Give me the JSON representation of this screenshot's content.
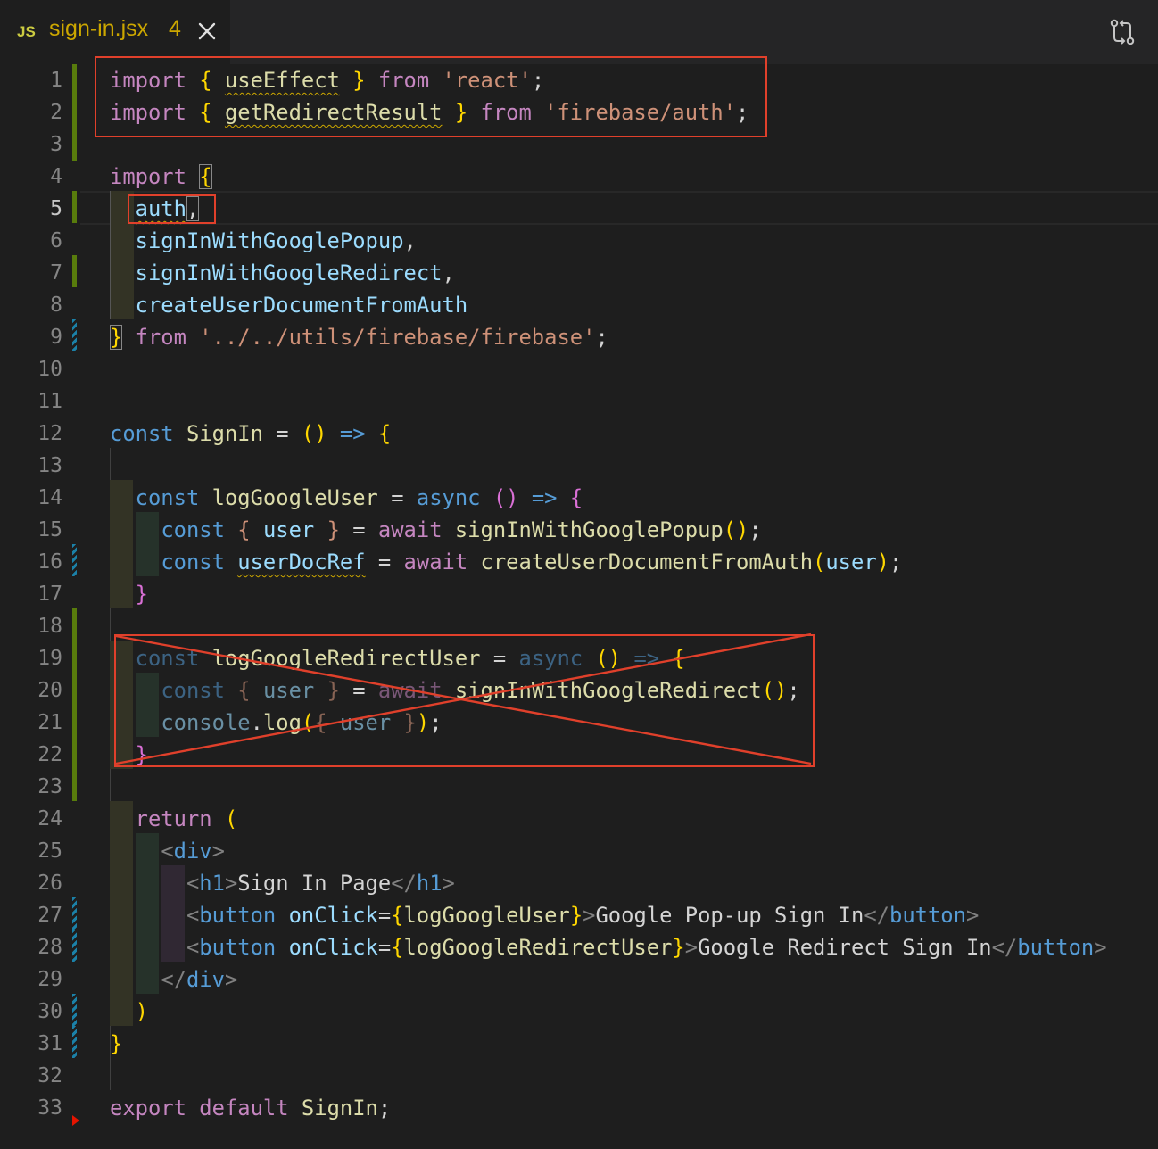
{
  "tab": {
    "language_badge": "JS",
    "filename": "sign-in.jsx",
    "problem_count": "4"
  },
  "icons": {
    "close": "close-icon",
    "compare": "git-compare-icon"
  },
  "colors": {
    "background": "#1e1e1e",
    "annotation": "#e0402b",
    "warning": "#cca700",
    "added": "#587c0c",
    "modified": "#1b81a8"
  },
  "editor": {
    "current_line": "5",
    "lines": [
      {
        "n": "1",
        "tokens": [
          [
            "k",
            "import"
          ],
          [
            "p",
            " "
          ],
          [
            "y",
            "{"
          ],
          [
            "p",
            " "
          ],
          [
            "f",
            "useEffect"
          ],
          [
            "p",
            " "
          ],
          [
            "y",
            "}"
          ],
          [
            "p",
            " "
          ],
          [
            "k",
            "from"
          ],
          [
            "p",
            " "
          ],
          [
            "s",
            "'react'"
          ],
          [
            "p",
            ";"
          ]
        ]
      },
      {
        "n": "2",
        "tokens": [
          [
            "k",
            "import"
          ],
          [
            "p",
            " "
          ],
          [
            "y",
            "{"
          ],
          [
            "p",
            " "
          ],
          [
            "f",
            "getRedirectResult"
          ],
          [
            "p",
            " "
          ],
          [
            "y",
            "}"
          ],
          [
            "p",
            " "
          ],
          [
            "k",
            "from"
          ],
          [
            "p",
            " "
          ],
          [
            "s",
            "'firebase/auth'"
          ],
          [
            "p",
            ";"
          ]
        ]
      },
      {
        "n": "3",
        "tokens": []
      },
      {
        "n": "4",
        "tokens": [
          [
            "k",
            "import"
          ],
          [
            "p",
            " "
          ],
          [
            "y",
            "{"
          ]
        ]
      },
      {
        "n": "5",
        "tokens": [
          [
            "p",
            "  "
          ],
          [
            "v",
            "auth"
          ],
          [
            "p",
            ","
          ]
        ]
      },
      {
        "n": "6",
        "tokens": [
          [
            "p",
            "  "
          ],
          [
            "v",
            "signInWithGooglePopup"
          ],
          [
            "p",
            ","
          ]
        ]
      },
      {
        "n": "7",
        "tokens": [
          [
            "p",
            "  "
          ],
          [
            "v",
            "signInWithGoogleRedirect"
          ],
          [
            "p",
            ","
          ]
        ]
      },
      {
        "n": "8",
        "tokens": [
          [
            "p",
            "  "
          ],
          [
            "v",
            "createUserDocumentFromAuth"
          ]
        ]
      },
      {
        "n": "9",
        "tokens": [
          [
            "y",
            "}"
          ],
          [
            "p",
            " "
          ],
          [
            "k",
            "from"
          ],
          [
            "p",
            " "
          ],
          [
            "s",
            "'../../utils/firebase/firebase'"
          ],
          [
            "p",
            ";"
          ]
        ]
      },
      {
        "n": "10",
        "tokens": []
      },
      {
        "n": "11",
        "tokens": []
      },
      {
        "n": "12",
        "tokens": [
          [
            "b",
            "const"
          ],
          [
            "p",
            " "
          ],
          [
            "f",
            "SignIn"
          ],
          [
            "p",
            " = "
          ],
          [
            "y",
            "()"
          ],
          [
            "p",
            " "
          ],
          [
            "b",
            "=>"
          ],
          [
            "p",
            " "
          ],
          [
            "y",
            "{"
          ]
        ]
      },
      {
        "n": "13",
        "tokens": []
      },
      {
        "n": "14",
        "tokens": [
          [
            "p",
            "  "
          ],
          [
            "b",
            "const"
          ],
          [
            "p",
            " "
          ],
          [
            "f",
            "logGoogleUser"
          ],
          [
            "p",
            " = "
          ],
          [
            "b",
            "async"
          ],
          [
            "p",
            " "
          ],
          [
            "m",
            "()"
          ],
          [
            "p",
            " "
          ],
          [
            "b",
            "=>"
          ],
          [
            "p",
            " "
          ],
          [
            "m",
            "{"
          ]
        ]
      },
      {
        "n": "15",
        "tokens": [
          [
            "p",
            "    "
          ],
          [
            "b",
            "const"
          ],
          [
            "p",
            " "
          ],
          [
            "s",
            "{"
          ],
          [
            "p",
            " "
          ],
          [
            "v",
            "user"
          ],
          [
            "p",
            " "
          ],
          [
            "s",
            "}"
          ],
          [
            "p",
            " = "
          ],
          [
            "k",
            "await"
          ],
          [
            "p",
            " "
          ],
          [
            "f",
            "signInWithGooglePopup"
          ],
          [
            "y",
            "()"
          ],
          [
            "p",
            ";"
          ]
        ]
      },
      {
        "n": "16",
        "tokens": [
          [
            "p",
            "    "
          ],
          [
            "b",
            "const"
          ],
          [
            "p",
            " "
          ],
          [
            "v",
            "userDocRef"
          ],
          [
            "p",
            " = "
          ],
          [
            "k",
            "await"
          ],
          [
            "p",
            " "
          ],
          [
            "f",
            "createUserDocumentFromAuth"
          ],
          [
            "y",
            "("
          ],
          [
            "v",
            "user"
          ],
          [
            "y",
            ")"
          ],
          [
            "p",
            ";"
          ]
        ]
      },
      {
        "n": "17",
        "tokens": [
          [
            "p",
            "  "
          ],
          [
            "m",
            "}"
          ]
        ]
      },
      {
        "n": "18",
        "tokens": []
      },
      {
        "n": "19",
        "tokens": [
          [
            "p",
            "  "
          ],
          [
            "b",
            "const"
          ],
          [
            "p",
            " "
          ],
          [
            "f",
            "logGoogleRedirectUser"
          ],
          [
            "p",
            " = "
          ],
          [
            "b",
            "async"
          ],
          [
            "p",
            " "
          ],
          [
            "y",
            "()"
          ],
          [
            "p",
            " "
          ],
          [
            "b",
            "=>"
          ],
          [
            "p",
            " "
          ],
          [
            "y",
            "{"
          ]
        ]
      },
      {
        "n": "20",
        "tokens": [
          [
            "p",
            "    "
          ],
          [
            "b",
            "const"
          ],
          [
            "p",
            " "
          ],
          [
            "s",
            "{"
          ],
          [
            "p",
            " "
          ],
          [
            "v",
            "user"
          ],
          [
            "p",
            " "
          ],
          [
            "s",
            "}"
          ],
          [
            "p",
            " = "
          ],
          [
            "k",
            "await"
          ],
          [
            "p",
            " "
          ],
          [
            "f",
            "signInWithGoogleRedirect"
          ],
          [
            "y",
            "()"
          ],
          [
            "p",
            ";"
          ]
        ]
      },
      {
        "n": "21",
        "tokens": [
          [
            "p",
            "    "
          ],
          [
            "v",
            "console"
          ],
          [
            "p",
            "."
          ],
          [
            "f",
            "log"
          ],
          [
            "y",
            "("
          ],
          [
            "s",
            "{"
          ],
          [
            "p",
            " "
          ],
          [
            "v",
            "user"
          ],
          [
            "p",
            " "
          ],
          [
            "s",
            "}"
          ],
          [
            "y",
            ")"
          ],
          [
            "p",
            ";"
          ]
        ]
      },
      {
        "n": "22",
        "tokens": [
          [
            "p",
            "  "
          ],
          [
            "m",
            "}"
          ]
        ]
      },
      {
        "n": "23",
        "tokens": []
      },
      {
        "n": "24",
        "tokens": [
          [
            "p",
            "  "
          ],
          [
            "k",
            "return"
          ],
          [
            "p",
            " "
          ],
          [
            "y",
            "("
          ]
        ]
      },
      {
        "n": "25",
        "tokens": [
          [
            "p",
            "    "
          ],
          [
            "g",
            "<"
          ],
          [
            "b",
            "div"
          ],
          [
            "g",
            ">"
          ]
        ]
      },
      {
        "n": "26",
        "tokens": [
          [
            "p",
            "      "
          ],
          [
            "g",
            "<"
          ],
          [
            "b",
            "h1"
          ],
          [
            "g",
            ">"
          ],
          [
            "p",
            "Sign In Page"
          ],
          [
            "g",
            "</"
          ],
          [
            "b",
            "h1"
          ],
          [
            "g",
            ">"
          ]
        ]
      },
      {
        "n": "27",
        "tokens": [
          [
            "p",
            "      "
          ],
          [
            "g",
            "<"
          ],
          [
            "b",
            "button"
          ],
          [
            "p",
            " "
          ],
          [
            "v",
            "onClick"
          ],
          [
            "p",
            "="
          ],
          [
            "y",
            "{"
          ],
          [
            "f",
            "logGoogleUser"
          ],
          [
            "y",
            "}"
          ],
          [
            "g",
            ">"
          ],
          [
            "p",
            "Google Pop-up Sign In"
          ],
          [
            "g",
            "</"
          ],
          [
            "b",
            "button"
          ],
          [
            "g",
            ">"
          ]
        ]
      },
      {
        "n": "28",
        "tokens": [
          [
            "p",
            "      "
          ],
          [
            "g",
            "<"
          ],
          [
            "b",
            "button"
          ],
          [
            "p",
            " "
          ],
          [
            "v",
            "onClick"
          ],
          [
            "p",
            "="
          ],
          [
            "y",
            "{"
          ],
          [
            "f",
            "logGoogleRedirectUser"
          ],
          [
            "y",
            "}"
          ],
          [
            "g",
            ">"
          ],
          [
            "p",
            "Google Redirect Sign In"
          ],
          [
            "g",
            "</"
          ],
          [
            "b",
            "button"
          ],
          [
            "g",
            ">"
          ]
        ]
      },
      {
        "n": "29",
        "tokens": [
          [
            "p",
            "    "
          ],
          [
            "g",
            "</"
          ],
          [
            "b",
            "div"
          ],
          [
            "g",
            ">"
          ]
        ]
      },
      {
        "n": "30",
        "tokens": [
          [
            "p",
            "  "
          ],
          [
            "y",
            ")"
          ]
        ]
      },
      {
        "n": "31",
        "tokens": [
          [
            "y",
            "}"
          ]
        ]
      },
      {
        "n": "32",
        "tokens": []
      },
      {
        "n": "33",
        "tokens": [
          [
            "k",
            "export"
          ],
          [
            "p",
            " "
          ],
          [
            "k",
            "default"
          ],
          [
            "p",
            " "
          ],
          [
            "f",
            "SignIn"
          ],
          [
            "p",
            ";"
          ]
        ]
      }
    ]
  }
}
